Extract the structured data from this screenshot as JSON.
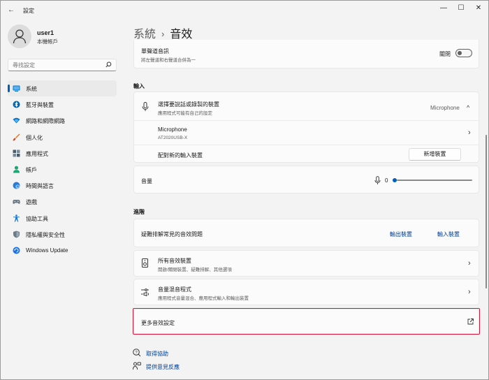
{
  "window": {
    "title": "設定",
    "back_glyph": "←",
    "min_glyph": "—",
    "max_glyph": "☐",
    "close_glyph": "✕"
  },
  "profile": {
    "name": "user1",
    "subtitle": "本機帳戶"
  },
  "search": {
    "placeholder": "尋找設定",
    "icon": "search-icon"
  },
  "sidebar": {
    "items": [
      {
        "label": "系統",
        "icon": "system-icon",
        "color": "#0078d4",
        "active": true
      },
      {
        "label": "藍牙與裝置",
        "icon": "bluetooth-icon",
        "color": "#0063b1"
      },
      {
        "label": "網路和網際網路",
        "icon": "wifi-icon",
        "color": "#0a73c9"
      },
      {
        "label": "個人化",
        "icon": "brush-icon",
        "color": "#e0781e"
      },
      {
        "label": "應用程式",
        "icon": "apps-icon",
        "color": "#4b5b6e"
      },
      {
        "label": "帳戶",
        "icon": "person-icon",
        "color": "#1ea672"
      },
      {
        "label": "時間與語言",
        "icon": "globe-clock-icon",
        "color": "#2a7ad8"
      },
      {
        "label": "遊戲",
        "icon": "gamepad-icon",
        "color": "#6e7a86"
      },
      {
        "label": "協助工具",
        "icon": "accessibility-icon",
        "color": "#1f77d0"
      },
      {
        "label": "隱私權與安全性",
        "icon": "shield-icon",
        "color": "#6a7b8c"
      },
      {
        "label": "Windows Update",
        "icon": "update-icon",
        "color": "#1a73e8"
      }
    ]
  },
  "breadcrumb": {
    "parent": "系統",
    "separator": "›",
    "current": "音效"
  },
  "mono_audio": {
    "title": "單聲道音訊",
    "subtitle": "將左聲道和右聲道合併為一",
    "toggle_label": "關閉"
  },
  "input_section": {
    "title": "輸入",
    "choose_device": {
      "title": "選擇要說話或錄製的裝置",
      "subtitle": "應用程式可能有自己的設定",
      "value": "Microphone",
      "chevron": "^"
    },
    "device": {
      "name": "Microphone",
      "model": "AT2020USB-X",
      "chevron": "›"
    },
    "pair_new": {
      "label": "配對新的輸入裝置",
      "button": "新增裝置"
    },
    "volume": {
      "label": "音量",
      "value": "0",
      "level": 0
    }
  },
  "advanced_section": {
    "title": "進階",
    "troubleshoot": {
      "label": "疑難排解常見的音效問題",
      "link_output": "輸出裝置",
      "link_input": "輸入裝置"
    },
    "all_devices": {
      "title": "所有音效裝置",
      "subtitle": "開啟/關閉裝置、疑難排解、其他選項",
      "chevron": "›"
    },
    "volume_mixer": {
      "title": "音量混音程式",
      "subtitle": "應用程式音量混合、應用程式輸入和輸出裝置",
      "chevron": "›"
    },
    "more_settings": {
      "label": "更多音效設定",
      "icon": "external-link-icon"
    }
  },
  "footer": {
    "get_help": "取得協助",
    "feedback": "提供意見反應"
  },
  "colors": {
    "accent": "#005fb8",
    "highlight": "#d1163b",
    "link": "#003e92"
  }
}
